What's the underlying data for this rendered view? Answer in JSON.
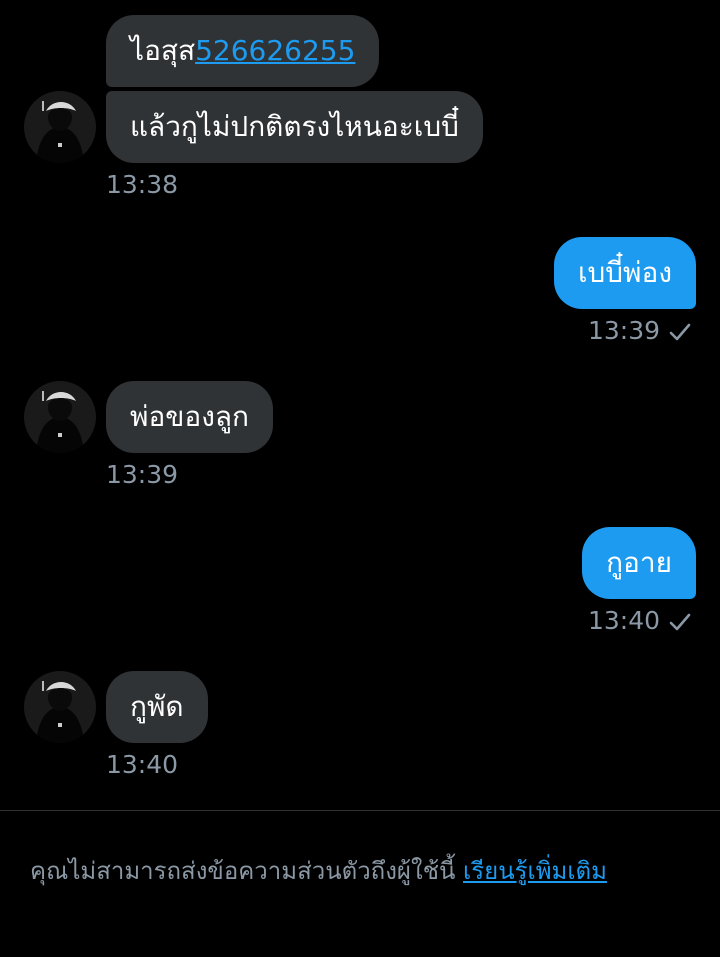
{
  "colors": {
    "background": "#000000",
    "incoming_bubble": "#2f3336",
    "outgoing_bubble": "#1d9bf0",
    "link": "#1d9bf0",
    "timestamp": "#8b98a5"
  },
  "messages": [
    {
      "direction": "incoming",
      "text": "ไอสุส",
      "link": "526626255"
    },
    {
      "direction": "incoming",
      "text": "แล้วกูไม่ปกติตรงไหนอะเบบี๋",
      "time": "13:38",
      "avatar": "avatar"
    },
    {
      "direction": "outgoing",
      "text": "เบบี๋พ่อง",
      "time": "13:39",
      "status_icon": "check-icon"
    },
    {
      "direction": "incoming",
      "text": "พ่อของลูก",
      "time": "13:39",
      "avatar": "avatar"
    },
    {
      "direction": "outgoing",
      "text": "กูอาย",
      "time": "13:40",
      "status_icon": "check-icon"
    },
    {
      "direction": "incoming",
      "text": "กูพัด",
      "time": "13:40",
      "avatar": "avatar"
    }
  ],
  "footer": {
    "notice": "คุณไม่สามารถส่งข้อความส่วนตัวถึงผู้ใช้นี้",
    "learn_more": "เรียนรู้เพิ่มเติม"
  }
}
